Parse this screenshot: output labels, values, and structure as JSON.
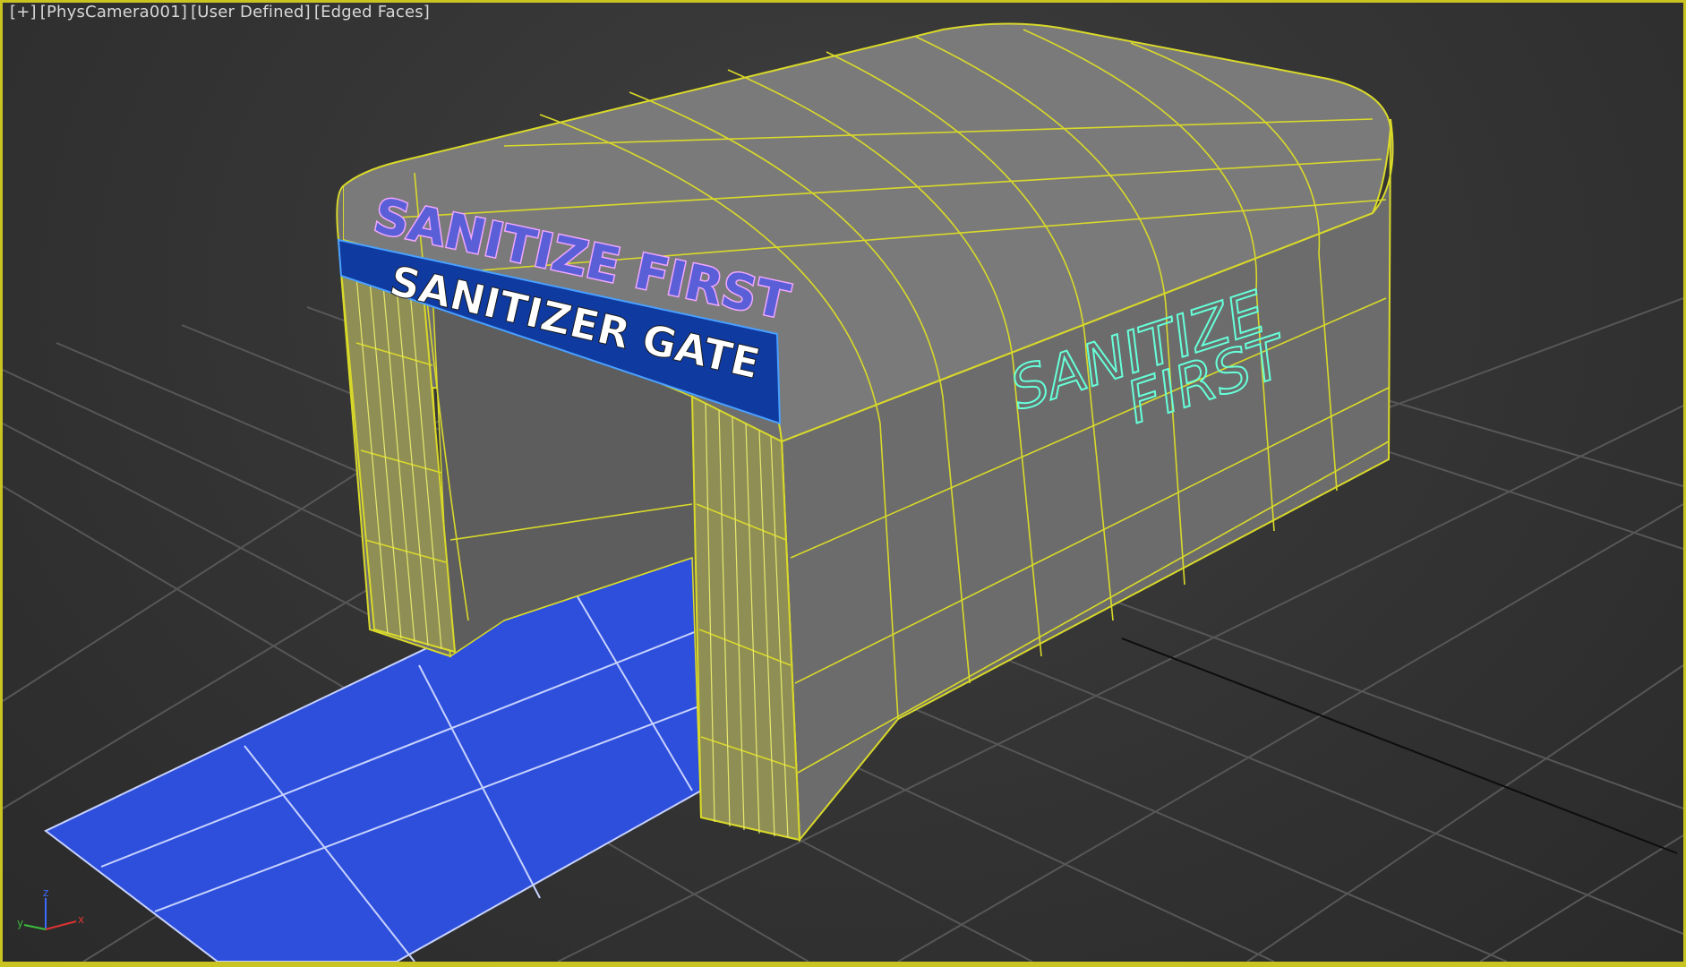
{
  "viewport": {
    "labels": [
      "[+]",
      "[PhysCamera001]",
      "[User Defined]",
      "[Edged Faces]"
    ],
    "border_color": "#c9c421"
  },
  "model": {
    "arch_sign_top": "SANITIZE FIRST",
    "arch_sign_banner": "SANITIZER GATE",
    "side_text_line1": "SANITIZE",
    "side_text_line2": "FIRST",
    "wire_color": "#d9d92a",
    "body_color": "#737373",
    "mat_color": "#2d4fdc",
    "banner_color": "#0f3aa0"
  },
  "axis_gizmo": {
    "x_label": "x",
    "y_label": "y",
    "z_label": "z"
  }
}
